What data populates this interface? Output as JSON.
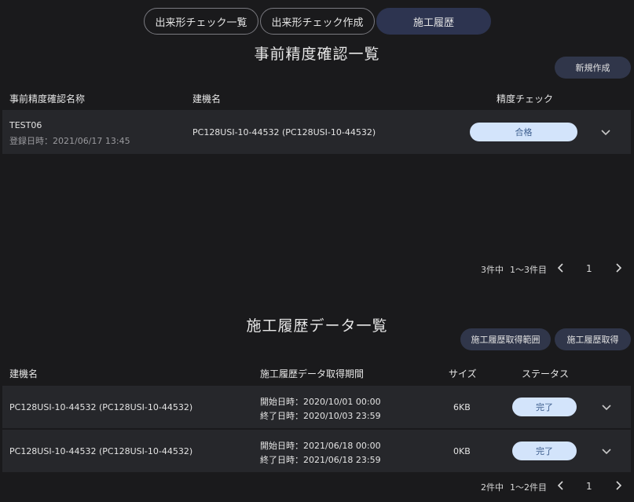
{
  "tabs": [
    {
      "label": "出来形チェック一覧"
    },
    {
      "label": "出来形チェック作成"
    },
    {
      "label": "施工履歴"
    }
  ],
  "precheck": {
    "title": "事前精度確認一覧",
    "new_button": "新規作成",
    "headers": {
      "name": "事前精度確認名称",
      "machine": "建機名",
      "check": "精度チェック"
    },
    "rows": [
      {
        "name": "TEST06",
        "registered": "登録日時：2021/06/17 13:45",
        "machine": "PC128USI-10-44532 (PC128USI-10-44532)",
        "status": "合格"
      }
    ],
    "pager": {
      "total": "3件中",
      "range": "1〜3件目",
      "page": "1"
    }
  },
  "history": {
    "title": "施工履歴データ一覧",
    "range_button": "施工履歴取得範囲",
    "fetch_button": "施工履歴取得",
    "headers": {
      "machine": "建機名",
      "period": "施工履歴データ取得期間",
      "size": "サイズ",
      "status": "ステータス"
    },
    "rows": [
      {
        "machine": "PC128USI-10-44532 (PC128USI-10-44532)",
        "start": "開始日時：2020/10/01 00:00",
        "end": "終了日時：2020/10/03 23:59",
        "size": "6KB",
        "status": "完了"
      },
      {
        "machine": "PC128USI-10-44532 (PC128USI-10-44532)",
        "start": "開始日時：2021/06/18 00:00",
        "end": "終了日時：2021/06/18 23:59",
        "size": "0KB",
        "status": "完了"
      }
    ],
    "pager": {
      "total": "2件中",
      "range": "1〜2件目",
      "page": "1"
    }
  },
  "colors": {
    "background": "#1a1a1c",
    "row": "#26272b",
    "accent": "#2d3450",
    "status_bg": "#d3e4fb",
    "status_text": "#3d5e8e"
  }
}
